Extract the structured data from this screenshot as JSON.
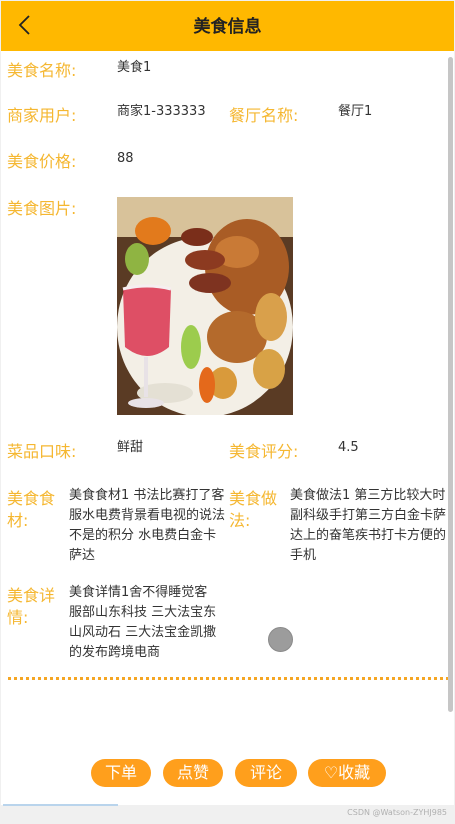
{
  "header": {
    "title": "美食信息"
  },
  "fields": {
    "name_label": "美食名称:",
    "name_value": "美食1",
    "merchant_label": "商家用户:",
    "merchant_value": "商家1-333333",
    "restaurant_label": "餐厅名称:",
    "restaurant_value": "餐厅1",
    "price_label": "美食价格:",
    "price_value": "88",
    "image_label": "美食图片:",
    "taste_label": "菜品口味:",
    "taste_value": "鲜甜",
    "rating_label": "美食评分:",
    "rating_value": "4.5",
    "ingredients_label_1": "美食食",
    "ingredients_label_2": "材:",
    "ingredients_value": "美食食材1 书法比赛打了客服水电费背景看电视的说法不是的积分 水电费白金卡萨达",
    "method_label_1": "美食做",
    "method_label_2": "法:",
    "method_value": "美食做法1 第三方比较大时副科级手打第三方白金卡萨达上的奋笔疾书打卡方便的手机",
    "details_label_1": "美食详",
    "details_label_2": "情:",
    "details_value": "美食详情1舍不得睡觉客服部山东科技 三大法宝东山风动石 三大法宝金凯撒的发布跨境电商"
  },
  "actions": {
    "order": "下单",
    "like": "点赞",
    "comment": "评论",
    "favorite": "♡收藏"
  },
  "watermark": "CSDN @Watson-ZYHJ985",
  "colors": {
    "header": "#FFB800",
    "label": "#F5B731",
    "button": "#FF9F1C"
  },
  "icons": {
    "back": "chevron-left-icon"
  }
}
